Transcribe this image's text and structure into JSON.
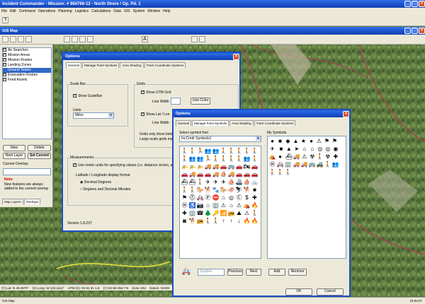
{
  "app": {
    "title": "Incident Commander - Mission: # 984766-12 - North Shore / Op. Pd. 1",
    "menu": [
      "File",
      "Edit",
      "Command",
      "Operations",
      "Planning",
      "Logistics",
      "Calculations",
      "Data",
      "GIS",
      "System",
      "Window",
      "Help"
    ]
  },
  "gis": {
    "title": "GIS Map"
  },
  "layers": {
    "items": [
      "Air Searches",
      "Mission Areas",
      "Mission Routes",
      "Landing Zones",
      "Ground Teams",
      "Evacuation Routes",
      "Feed Assets"
    ],
    "selected_index": 4
  },
  "left": {
    "new": "New",
    "delete": "Delete",
    "rem": "Rem Layer",
    "set_current": "Set Current",
    "current_overlay": "Current Overlay:",
    "note_title": "Note:",
    "note_text": "New features are always added to the current overlay",
    "tab_map": "Map Layers",
    "tab_overlays": "Overlays"
  },
  "opt1": {
    "title": "Options",
    "tabs": [
      "General",
      "Manage Point Symbols",
      "Area Shading",
      "Track Coordinate Systems"
    ],
    "scalebar": "Scale Bar",
    "show_scalebar": "Show ScaleBar",
    "units": "Units",
    "units_value": "Miles",
    "grids": "Grids",
    "show_utm": "Show UTM Grid",
    "line_width": "Line Width",
    "line_color": "Line Color",
    "show_latlong": "Show Lat / Lon",
    "line_width2": "Line Width",
    "grids_note": "Grids only show below",
    "grids_note2": "Large-scale grids may",
    "measurements": "Measurements",
    "metric": "Use metric units for specifying values (i.e. distance circles, area",
    "latlong": "Latitude / Longitude display format",
    "dd": "Decimal Degrees",
    "dm": "Degrees and Decimal Minutes",
    "version": "Version 1.8.237"
  },
  "opt2": {
    "title": "Options",
    "tabs": [
      "General",
      "Manage Point Symbols",
      "Area Shading",
      "Track Coordinate Systems"
    ],
    "select_font": "Select symbol font",
    "font": "IncCmdr Symbols1",
    "my_symbols": "My Symbols",
    "sym_label": "Symbol",
    "previous": "Previous",
    "next": "Next",
    "add": "Add",
    "remove": "Remove",
    "ok": "OK",
    "cancel": "Cancel"
  },
  "status": {
    "lat": "(Y) Lat: N 49.3670°",
    "lon": "(X) Long: W 123.1114°",
    "utm": "UTM (X): 04 91 91 1.E",
    "utm2": "(Y) 54 68 256.7 N",
    "zone": "Zone 10U",
    "datum": "Datum: NAD8",
    "bottom": "GIS Map",
    "time": "19:32:07"
  }
}
